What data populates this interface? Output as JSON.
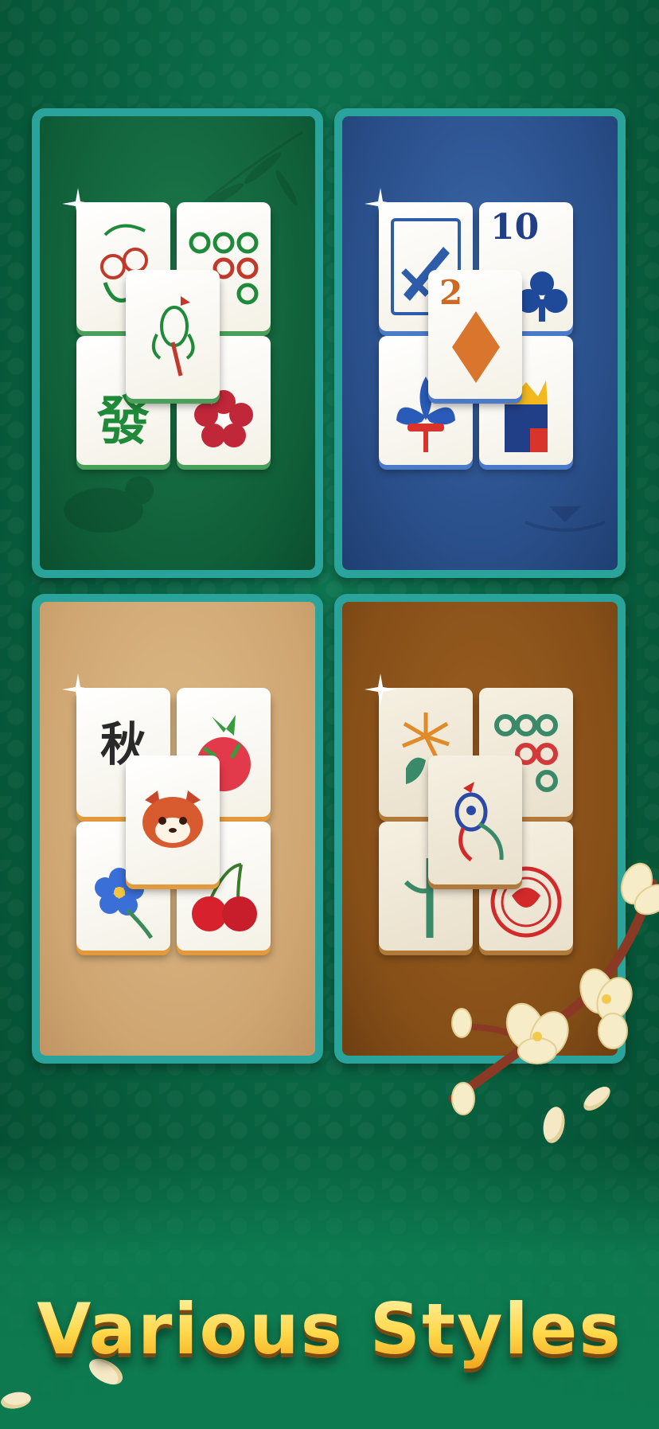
{
  "title": "Various Styles",
  "colors": {
    "background": "#08603f",
    "card_frame": "#2aa39a",
    "title_gold": "#ffd84a"
  },
  "styles": [
    {
      "name": "classic",
      "background": "#10603a",
      "tiles": [
        "fruit-tile",
        "circles-tile",
        "fa-character-tile",
        "plum-flower-tile"
      ],
      "top_tile": "bird-tile",
      "fa_char": "發"
    },
    {
      "name": "poker",
      "background": "#2a4f8a",
      "tiles": [
        "sword-tile",
        "ten-clubs-tile",
        "fleur-de-lis-tile",
        "king-tile"
      ],
      "top_tile": "two-diamonds-tile",
      "ten_label": "10",
      "two_label": "2"
    },
    {
      "name": "cute",
      "background": "#cfa672",
      "tiles": [
        "autumn-character-tile",
        "dragon-fruit-tile",
        "blue-flower-tile",
        "cherries-tile"
      ],
      "top_tile": "red-panda-tile",
      "autumn_char": "秋"
    },
    {
      "name": "antique",
      "background": "#864f18",
      "tiles": [
        "chrysanthemum-tile",
        "six-circles-tile",
        "bamboo-tile",
        "red-seal-tile"
      ],
      "top_tile": "peacock-tile"
    }
  ]
}
